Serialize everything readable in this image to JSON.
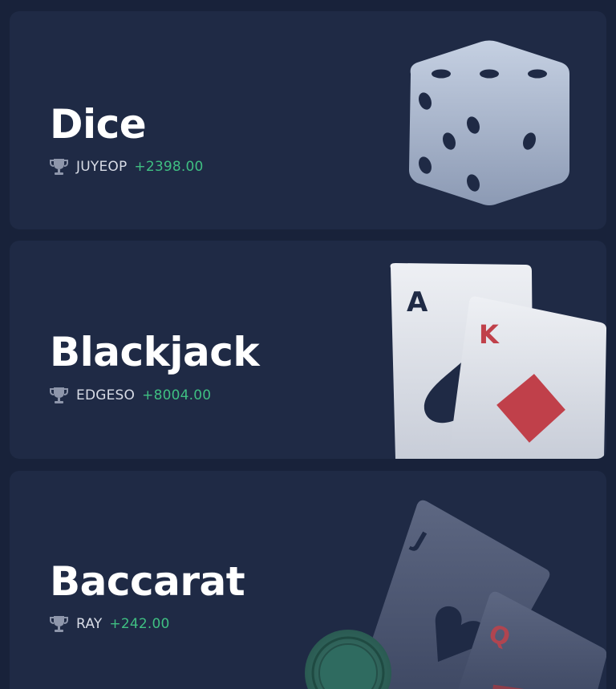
{
  "games": [
    {
      "title": "Dice",
      "winner": "JUYEOP",
      "amount": "+2398.00"
    },
    {
      "title": "Blackjack",
      "winner": "EDGESO",
      "amount": "+8004.00"
    },
    {
      "title": "Baccarat",
      "winner": "RAY",
      "amount": "+242.00"
    }
  ],
  "cards_art": {
    "blackjack_back_rank": "A",
    "blackjack_front_rank": "K",
    "baccarat_back_rank": "J",
    "baccarat_front_rank": "Q"
  },
  "colors": {
    "page_bg": "#18223a",
    "card_bg": "#1f2a45",
    "amount_green": "#3fbf82",
    "suit_red": "#c0404a",
    "suit_navy": "#1f2a45",
    "chip_green": "#2f6b60"
  },
  "icons": {
    "trophy": "trophy-icon",
    "dice": "dice-icon"
  }
}
